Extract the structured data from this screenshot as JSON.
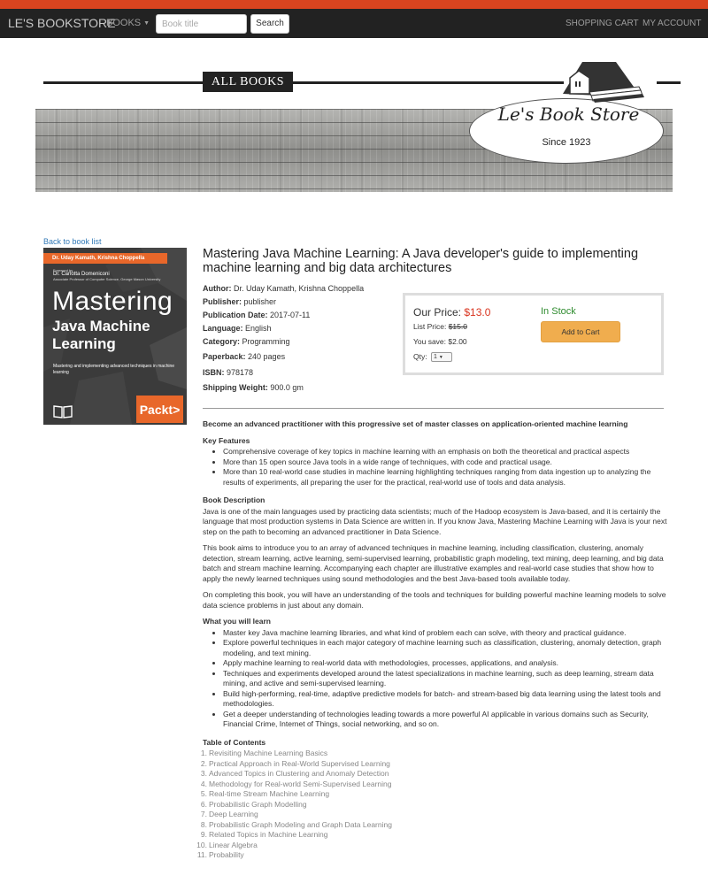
{
  "navbar": {
    "brand": "LE'S BOOKSTORE",
    "books_menu": "BOOKS",
    "search_placeholder": "Book title",
    "search_button": "Search",
    "cart": "SHOPPING CART",
    "account": "MY ACCOUNT"
  },
  "hero": {
    "all_books": "ALL BOOKS",
    "store_name": "Le's Book Store",
    "since": "Since 1923"
  },
  "product": {
    "back_link": "Back to book list",
    "cover": {
      "authors": "Dr. Uday Kamath, Krishna Choppella",
      "foreword_label": "Foreword by",
      "foreword_name": "Dr. Carlotta Domeniconi",
      "foreword_role": "Associate Professor of Computer Science, George Mason University",
      "title_line1": "Mastering",
      "title_line2": "Java Machine",
      "title_line3": "Learning",
      "tagline": "Mastering and implementing advanced techniques in machine learning",
      "publisher_logo": "Packt>"
    },
    "title": "Mastering Java Machine Learning: A Java developer's guide to implementing machine learning and big data architectures",
    "details": [
      {
        "label": "Author:",
        "value": " Dr. Uday Kamath, Krishna Choppella"
      },
      {
        "label": "Publisher:",
        "value": " publisher"
      },
      {
        "label": "Publication Date:",
        "value": " 2017-07-11"
      },
      {
        "label": "Language:",
        "value": " English"
      },
      {
        "label": "Category:",
        "value": " Programming"
      },
      {
        "label": "Paperback:",
        "value": " 240 pages"
      },
      {
        "label": "ISBN:",
        "value": " 978178"
      },
      {
        "label": "Shipping Weight:",
        "value": " 900.0 gm"
      }
    ],
    "price": {
      "our_price_label": "Our Price:",
      "our_price_value": "$13.0",
      "list_price_label": "List Price:",
      "list_price_value": "$15.0",
      "you_save": "You save: $2.00",
      "qty_label": "Qty:",
      "qty_value": "1",
      "stock": "In Stock",
      "add_to_cart": "Add to Cart"
    },
    "description": {
      "headline": "Become an advanced practitioner with this progressive set of master classes on application-oriented machine learning",
      "key_features_title": "Key Features",
      "key_features": [
        "Comprehensive coverage of key topics in machine learning with an emphasis on both the theoretical and practical aspects",
        "More than 15 open source Java tools in a wide range of techniques, with code and practical usage.",
        "More than 10 real-world case studies in machine learning highlighting techniques ranging from data ingestion up to analyzing the results of experiments, all preparing the user for the practical, real-world use of tools and data analysis."
      ],
      "book_description_title": "Book Description",
      "paragraphs": [
        "Java is one of the main languages used by practicing data scientists; much of the Hadoop ecosystem is Java-based, and it is certainly the language that most production systems in Data Science are written in. If you know Java, Mastering Machine Learning with Java is your next step on the path to becoming an advanced practitioner in Data Science.",
        "This book aims to introduce you to an array of advanced techniques in machine learning, including classification, clustering, anomaly detection, stream learning, active learning, semi-supervised learning, probabilistic graph modeling, text mining, deep learning, and big data batch and stream machine learning. Accompanying each chapter are illustrative examples and real-world case studies that show how to apply the newly learned techniques using sound methodologies and the best Java-based tools available today.",
        "On completing this book, you will have an understanding of the tools and techniques for building powerful machine learning models to solve data science problems in just about any domain."
      ],
      "learn_title": "What you will learn",
      "learn": [
        "Master key Java machine learning libraries, and what kind of problem each can solve, with theory and practical guidance.",
        "Explore powerful techniques in each major category of machine learning such as classification, clustering, anomaly detection, graph modeling, and text mining.",
        "Apply machine learning to real-world data with methodologies, processes, applications, and analysis.",
        "Techniques and experiments developed around the latest specializations in machine learning, such as deep learning, stream data mining, and active and semi-supervised learning.",
        "Build high-performing, real-time, adaptive predictive models for batch- and stream-based big data learning using the latest tools and methodologies.",
        "Get a deeper understanding of technologies leading towards a more powerful AI applicable in various domains such as Security, Financial Crime, Internet of Things, social networking, and so on."
      ],
      "toc_title": "Table of Contents",
      "toc": [
        "Revisiting Machine Learning Basics",
        "Practical Approach in Real-World Supervised Learning",
        "Advanced Topics in Clustering and Anomaly Detection",
        "Methodology for Real-world Semi-Supervised Learning",
        "Real-time Stream Machine Learning",
        "Probabilistic Graph Modelling",
        "Deep Learning",
        "Probabilistic Graph Modeling and Graph Data Learning",
        "Related Topics in Machine Learning",
        "Linear Algebra",
        "Probability"
      ]
    }
  },
  "colors": {
    "top_strip": "#d9441f",
    "navbar_bg": "#222222",
    "price_red": "#d9341f",
    "stock_green": "#2e8b2e",
    "cart_button": "#f0ad4e",
    "link_blue": "#337ab7",
    "cover_orange": "#e8672a"
  }
}
